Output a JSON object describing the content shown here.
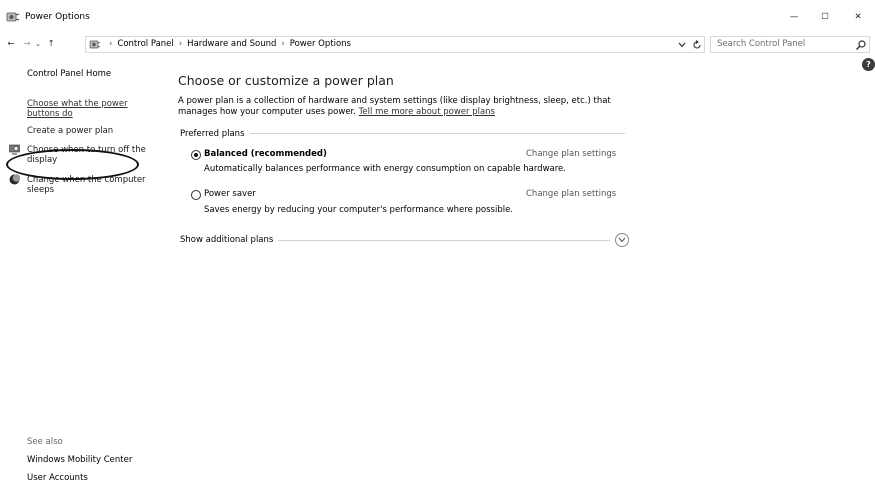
{
  "window": {
    "title": "Power Options",
    "controls": {
      "minimize": "—",
      "maximize": "☐",
      "close": "✕"
    }
  },
  "nav": {
    "back": "←",
    "forward": "→",
    "recent": "⌄",
    "up": "↑",
    "breadcrumbs": [
      "Control Panel",
      "Hardware and Sound",
      "Power Options"
    ],
    "separator": "›",
    "search_placeholder": "Search Control Panel"
  },
  "help": "?",
  "sidebar": {
    "home": "Control Panel Home",
    "links": [
      {
        "label_line1": "Choose what the power",
        "label_line2": "buttons do"
      },
      {
        "label_line1": "Create a power plan"
      },
      {
        "label_line1": "Choose when to turn off the",
        "label_line2": "display",
        "icon": "display-icon"
      },
      {
        "label_line1": "Change when the computer",
        "label_line2": "sleeps",
        "icon": "moon-icon"
      }
    ],
    "see_also": "See also",
    "see_also_links": [
      "Windows Mobility Center",
      "User Accounts"
    ]
  },
  "main": {
    "title": "Choose or customize a power plan",
    "description": "A power plan is a collection of hardware and system settings (like display brightness, sleep, etc.) that manages how your computer uses power.",
    "learn_more": "Tell me more about power plans",
    "preferred_label": "Preferred plans",
    "plans": [
      {
        "name": "Balanced (recommended)",
        "selected": true,
        "description": "Automatically balances performance with energy consumption on capable hardware.",
        "change": "Change plan settings"
      },
      {
        "name": "Power saver",
        "selected": false,
        "description": "Saves energy by reducing your computer's performance where possible.",
        "change": "Change plan settings"
      }
    ],
    "additional_label": "Show additional plans"
  }
}
